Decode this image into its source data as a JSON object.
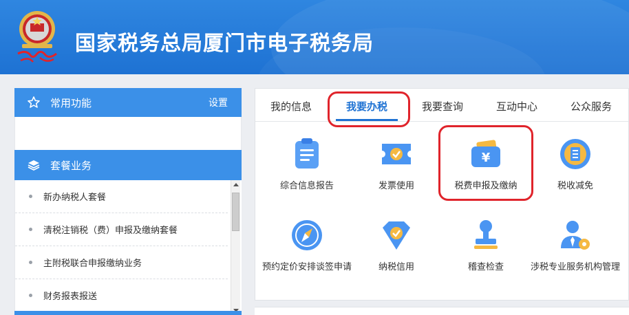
{
  "header": {
    "title": "国家税务总局厦门市电子税务局",
    "emblem_icon": "national-tax-emblem-icon"
  },
  "colors": {
    "header_blue": "#1e72d3",
    "panel_blue": "#3b90e8",
    "highlight_red": "#e0242b",
    "active_tab": "#1e72d3"
  },
  "sidebar": {
    "common": {
      "label": "常用功能",
      "setting": "设置",
      "icon": "star-icon"
    },
    "package": {
      "label": "套餐业务",
      "icon": "layers-icon"
    },
    "items": [
      {
        "label": "新办纳税人套餐"
      },
      {
        "label": "清税注销税（费）申报及缴纳套餐"
      },
      {
        "label": "主附税联合申报缴纳业务"
      },
      {
        "label": "财务报表报送"
      }
    ]
  },
  "tabs": [
    {
      "label": "我的信息",
      "active": false
    },
    {
      "label": "我要办税",
      "active": true
    },
    {
      "label": "我要查询",
      "active": false
    },
    {
      "label": "互动中心",
      "active": false
    },
    {
      "label": "公众服务",
      "active": false
    }
  ],
  "grid": [
    {
      "label": "综合信息报告",
      "icon": "clipboard-report-icon"
    },
    {
      "label": "发票使用",
      "icon": "invoice-ticket-icon"
    },
    {
      "label": "税费申报及缴纳",
      "icon": "yuan-wallet-icon",
      "highlighted": true
    },
    {
      "label": "税收减免",
      "icon": "tax-coin-icon"
    },
    {
      "label": "预约定价安排谈签申请",
      "icon": "compass-icon"
    },
    {
      "label": "纳税信用",
      "icon": "credit-shield-icon"
    },
    {
      "label": "稽查检查",
      "icon": "stamp-inspection-icon"
    },
    {
      "label": "涉税专业服务机构管理",
      "icon": "agent-gear-icon"
    }
  ]
}
